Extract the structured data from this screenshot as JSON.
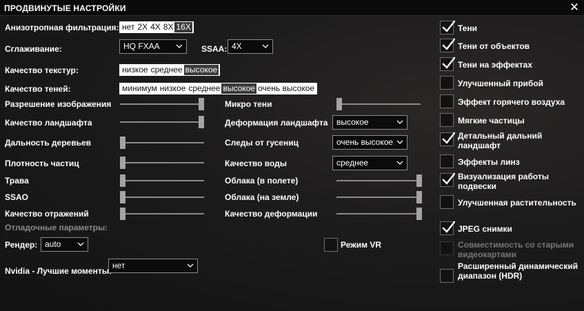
{
  "window": {
    "title": "ПРОДВИНУТЫЕ НАСТРОЙКИ",
    "close_icon": "close-icon"
  },
  "aniso": {
    "label": "Анизотропная фильтрация:",
    "options": [
      "нет",
      "2X",
      "4X",
      "8X",
      "16X"
    ],
    "selected": "16X"
  },
  "antialias": {
    "label": "Сглаживание:",
    "value": "HQ FXAA"
  },
  "ssaa": {
    "label": "SSAA:",
    "value": "4X"
  },
  "textures": {
    "label": "Качество текстур:",
    "options": [
      "низкое",
      "среднее",
      "высокое"
    ],
    "selected": "высокое"
  },
  "shadows": {
    "label": "Качество теней:",
    "options": [
      "минимум",
      "низкое",
      "среднее",
      "высокое",
      "очень высокое"
    ],
    "selected": "высокое"
  },
  "sliders": {
    "resolution": {
      "label": "Разрешение изображения",
      "value": 1.0
    },
    "landscape": {
      "label": "Качество ландшафта",
      "value": 1.0
    },
    "tree_distance": {
      "label": "Дальность деревьев",
      "value": 0.0
    },
    "particles_density": {
      "label": "Плотность частиц",
      "value": 0.0
    },
    "grass": {
      "label": "Трава",
      "value": 0.0
    },
    "ssao": {
      "label": "SSAO",
      "value": 0.0
    },
    "reflections": {
      "label": "Качество отражений",
      "value": 0.0
    },
    "micro_shadows": {
      "label": "Микро тени",
      "value": 0.0
    },
    "clouds_flight": {
      "label": "Облака (в полете)",
      "value": 1.0
    },
    "clouds_ground": {
      "label": "Облака (на земле)",
      "value": 1.0
    },
    "deformation": {
      "label": "Качество деформации",
      "value": 1.0
    }
  },
  "landscape_deform": {
    "label": "Деформация ландшафта",
    "value": "высокое"
  },
  "tracks": {
    "label": "Следы от гусениц",
    "value": "очень высокое"
  },
  "water": {
    "label": "Качество воды",
    "value": "среднее"
  },
  "debug": {
    "section": "Отладочные параметры:",
    "render_label": "Рендер:",
    "render_value": "auto",
    "vr_label": "Режим VR",
    "vr_checked": false
  },
  "nvidia": {
    "label": "Nvidia - Лучшие моменты:",
    "value": "нет"
  },
  "checkboxes": [
    {
      "label": "Тени",
      "checked": true,
      "disabled": false
    },
    {
      "label": "Тени от объектов",
      "checked": true,
      "disabled": false
    },
    {
      "label": "Тени на эффектах",
      "checked": true,
      "disabled": false
    },
    {
      "label": "Улучшенный прибой",
      "checked": false,
      "disabled": false
    },
    {
      "label": "Эффект горячего воздуха",
      "checked": false,
      "disabled": false
    },
    {
      "label": "Мягкие частицы",
      "checked": false,
      "disabled": false
    },
    {
      "label": "Детальный дальний ландшафт",
      "checked": true,
      "disabled": false
    },
    {
      "label": "Эффекты линз",
      "checked": false,
      "disabled": false
    },
    {
      "label": "Визуализация работы подвески",
      "checked": true,
      "disabled": false
    },
    {
      "label": "Улучшенная растительность",
      "checked": false,
      "disabled": false
    },
    {
      "label": "JPEG снимки",
      "checked": true,
      "disabled": false
    },
    {
      "label": "Совместимость со старыми видеокартами",
      "checked": false,
      "disabled": true
    },
    {
      "label": "Расширенный динамический диапазон (HDR)",
      "checked": false,
      "disabled": false
    }
  ]
}
